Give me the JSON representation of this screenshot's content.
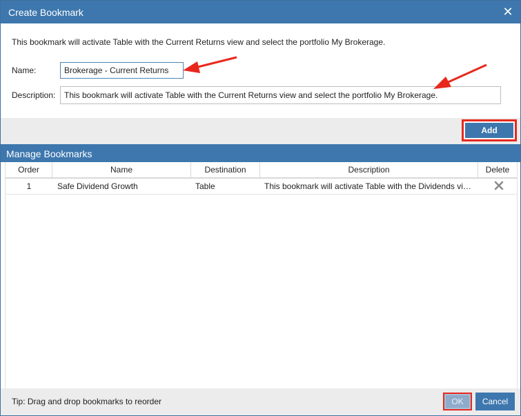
{
  "dialog": {
    "title": "Create Bookmark",
    "close_label": "✕"
  },
  "create": {
    "intro": "This bookmark will activate Table with the Current Returns view and select the portfolio My Brokerage.",
    "name_label": "Name:",
    "name_value": "Brokerage - Current Returns",
    "description_label": "Description:",
    "description_value": "This bookmark will activate Table with the Current Returns view and select the portfolio My Brokerage.",
    "add_label": "Add"
  },
  "manage": {
    "title": "Manage Bookmarks",
    "columns": [
      "Order",
      "Name",
      "Destination",
      "Description",
      "Delete"
    ],
    "rows": [
      {
        "order": "1",
        "name": "Safe Dividend Growth",
        "destination": "Table",
        "description": "This bookmark will activate Table with the Dividends view and select the portfolio My Brokerage."
      }
    ]
  },
  "footer": {
    "tip": "Tip: Drag and drop bookmarks to reorder",
    "ok_label": "OK",
    "cancel_label": "Cancel"
  },
  "colors": {
    "header_blue": "#3d77ad",
    "highlight_red": "#e8281d",
    "panel_gray": "#ececec"
  }
}
